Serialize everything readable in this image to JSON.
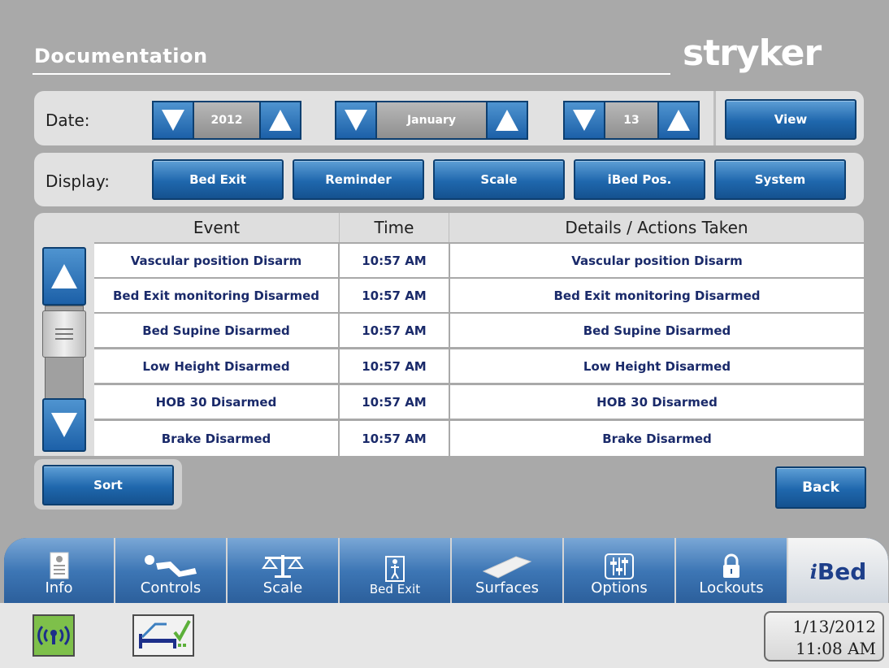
{
  "header": {
    "title": "Documentation",
    "logo": "stryker"
  },
  "date_filter": {
    "label": "Date:",
    "year": "2012",
    "month": "January",
    "day": "13",
    "view_label": "View"
  },
  "display_filter": {
    "label": "Display:",
    "buttons": [
      "Bed Exit",
      "Reminder",
      "Scale",
      "iBed Pos.",
      "System"
    ]
  },
  "table": {
    "columns": [
      "Event",
      "Time",
      "Details / Actions Taken"
    ],
    "rows": [
      {
        "event": "Vascular position Disarm",
        "time": "10:57 AM",
        "details": "Vascular position Disarm"
      },
      {
        "event": "Bed Exit monitoring Disarmed",
        "time": "10:57 AM",
        "details": "Bed Exit monitoring Disarmed"
      },
      {
        "event": "Bed Supine Disarmed",
        "time": "10:57 AM",
        "details": "Bed Supine Disarmed"
      },
      {
        "event": "Low Height Disarmed",
        "time": "10:57 AM",
        "details": "Low Height Disarmed"
      },
      {
        "event": "HOB 30 Disarmed",
        "time": "10:57 AM",
        "details": "HOB 30 Disarmed"
      },
      {
        "event": "Brake Disarmed",
        "time": "10:57 AM",
        "details": "Brake Disarmed"
      }
    ]
  },
  "actions": {
    "sort_label": "Sort",
    "back_label": "Back"
  },
  "nav": {
    "tabs": [
      {
        "label": "Info",
        "icon": "info-card-icon"
      },
      {
        "label": "Controls",
        "icon": "patient-bed-icon"
      },
      {
        "label": "Scale",
        "icon": "scale-icon"
      },
      {
        "label": "Bed Exit",
        "icon": "bed-exit-person-icon"
      },
      {
        "label": "Surfaces",
        "icon": "mattress-icon"
      },
      {
        "label": "Options",
        "icon": "sliders-icon"
      },
      {
        "label": "Lockouts",
        "icon": "lock-icon"
      }
    ],
    "brand": {
      "prefix": "i",
      "name": "Bed"
    }
  },
  "status_bar": {
    "wireless_icon": "wireless-signal-icon",
    "bed_icon": "bed-check-icon",
    "date": "1/13/2012",
    "time": "11:08 AM"
  },
  "colors": {
    "button_blue": "#1f67ad",
    "background": "#a9a9a9",
    "panel": "#e1e1e1",
    "text_navy": "#1a2a6a"
  }
}
